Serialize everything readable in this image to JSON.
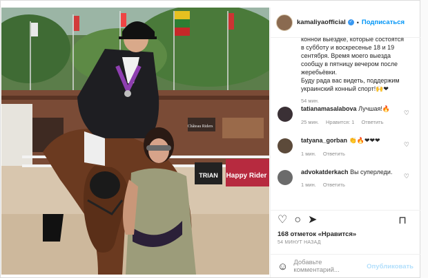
{
  "post": {
    "username": "kamaliyaofficial",
    "follow_label": "Подписаться",
    "caption_lines": [
      "конной выездке, которые состоятся",
      "в субботу и воскресенье 18 и 19",
      "сентября. Время моего выезда",
      "сообщу в пятницу вечером после",
      "жеребьёвки.",
      "Буду рада вас видеть, поддержим",
      "украинский конный спорт!🙌❤"
    ],
    "caption_time": "54 мин.",
    "comments": [
      {
        "user": "tatianamasalabova",
        "text": "Лучшая!🔥",
        "time": "25 мин.",
        "likes": "Нравится: 1",
        "reply": "Ответить",
        "avatar_color": "#3a3035"
      },
      {
        "user": "tatyana_gorban",
        "text": "👏🔥❤❤❤",
        "time": "1 мин.",
        "reply": "Ответить",
        "avatar_color": "#5c4a3a"
      },
      {
        "user": "advokatderkach",
        "text": "Вы суперледи.",
        "time": "1 мин.",
        "reply": "Ответить",
        "avatar_color": "#6b6b6b"
      }
    ],
    "likes_count": "168 отметок",
    "likes_label": "«Нравится»",
    "time_ago": "54 МИНУТ НАЗАД",
    "comment_placeholder": "Добавьте комментарий...",
    "publish_label": "Опубликовать"
  },
  "photo": {
    "banner_text": "Happy Rider",
    "sign_text": "Château Riders",
    "fence_text": "TRIAN"
  },
  "icons": {
    "like": "heart-icon",
    "comment": "comment-icon",
    "share": "share-icon",
    "save": "bookmark-icon",
    "emoji": "emoji-icon"
  }
}
